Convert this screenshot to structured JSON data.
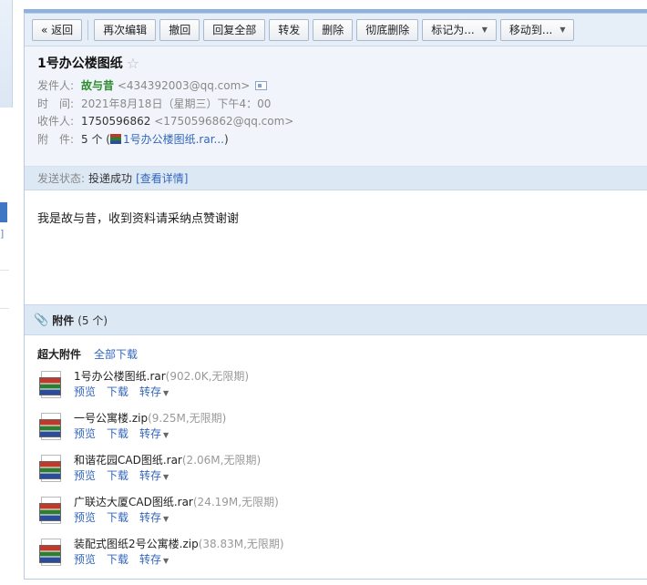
{
  "toolbar": {
    "back": "« 返回",
    "reedit": "再次编辑",
    "undo": "撤回",
    "reply_all": "回复全部",
    "forward": "转发",
    "delete": "删除",
    "delete_forever": "彻底删除",
    "mark_as": "标记为...",
    "move_to": "移动到..."
  },
  "mail": {
    "subject": "1号办公楼图纸",
    "sender_label": "发件人:",
    "sender_name": "故与昔",
    "sender_email": "<434392003@qq.com>",
    "time_label": "时　间:",
    "time": "2021年8月18日（星期三）下午4：00",
    "recipient_label": "收件人:",
    "recipient_name": "1750596862",
    "recipient_email": "<1750596862@qq.com>",
    "attach_label": "附　件:",
    "attach_count": "5 个 (",
    "attach_first": "1号办公楼图纸.rar...",
    "attach_close": ")",
    "status_label": "发送状态:",
    "status": "投递成功",
    "status_detail": "[查看详情]",
    "body": "我是故与昔，收到资料请采纳点赞谢谢"
  },
  "attachments": {
    "title": "附件",
    "count": "(5 个)",
    "big_label": "超大附件",
    "download_all": "全部下载",
    "preview": "预览",
    "download": "下载",
    "save": "转存",
    "files": [
      {
        "name": "1号办公楼图纸.rar",
        "meta": "(902.0K,无限期)"
      },
      {
        "name": "一号公寓楼.zip",
        "meta": "(9.25M,无限期)"
      },
      {
        "name": "和谐花园CAD图纸.rar",
        "meta": "(2.06M,无限期)"
      },
      {
        "name": "广联达大厦CAD图纸.rar",
        "meta": "(24.19M,无限期)"
      },
      {
        "name": "装配式图纸2号公寓楼.zip",
        "meta": "(38.83M,无限期)"
      }
    ]
  }
}
